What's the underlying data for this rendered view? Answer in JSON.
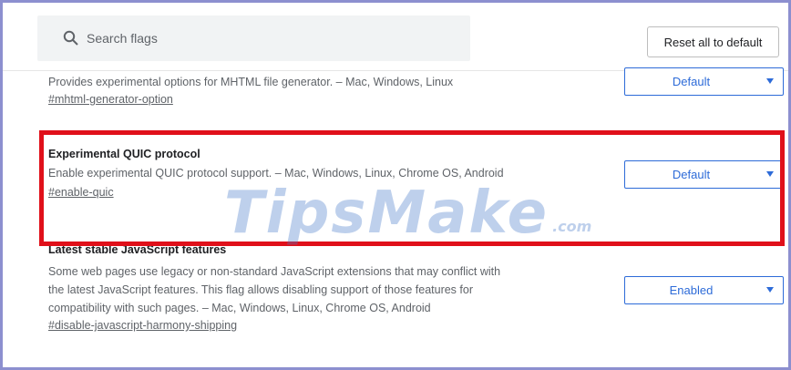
{
  "search": {
    "placeholder": "Search flags",
    "icon": "search-icon"
  },
  "toolbar": {
    "reset_label": "Reset all to default"
  },
  "flags": [
    {
      "description": "Provides experimental options for MHTML file generator. – Mac, Windows, Linux",
      "hash": "#mhtml-generator-option",
      "value": "Default"
    },
    {
      "title": "Experimental QUIC protocol",
      "description": "Enable experimental QUIC protocol support. – Mac, Windows, Linux, Chrome OS, Android",
      "hash": "#enable-quic",
      "value": "Default"
    },
    {
      "title": "Latest stable JavaScript features",
      "description_lines": [
        "Some web pages use legacy or non-standard JavaScript extensions that may conflict with",
        "the latest JavaScript features. This flag allows disabling support of those features for",
        "compatibility with such pages. – Mac, Windows, Linux, Chrome OS, Android"
      ],
      "hash": "#disable-javascript-harmony-shipping",
      "value": "Enabled"
    }
  ],
  "watermark": {
    "text": "TipsMake",
    "tld": ".com"
  },
  "colors": {
    "accent": "#2d6bd8",
    "highlight": "#e0101a",
    "frame": "#8c8fcf"
  }
}
